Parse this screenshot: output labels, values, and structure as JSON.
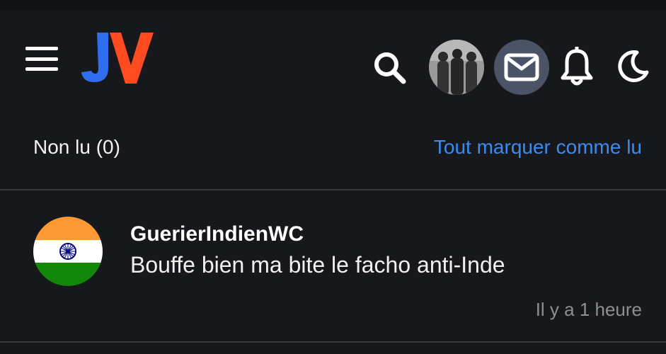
{
  "header": {
    "logo_text": "JV",
    "icons": {
      "menu": "menu-icon",
      "search": "search-icon",
      "avatar": "user-avatar",
      "messages": "mail-icon",
      "notifications": "bell-icon",
      "theme": "moon-icon"
    }
  },
  "subbar": {
    "unread_label": "Non lu (0)",
    "mark_all_label": "Tout marquer comme lu"
  },
  "notifications": [
    {
      "user": "GuerierIndienWC",
      "message": "Bouffe bien ma bite le facho anti-Inde",
      "time": "Il y a 1 heure",
      "avatar": "india-flag-avatar"
    }
  ],
  "colors": {
    "background": "#17181c",
    "accent_link": "#3d8bf0",
    "logo_blue": "#2f6ef0",
    "logo_orange": "#ff4b1f",
    "mail_bg": "#4a5466"
  }
}
